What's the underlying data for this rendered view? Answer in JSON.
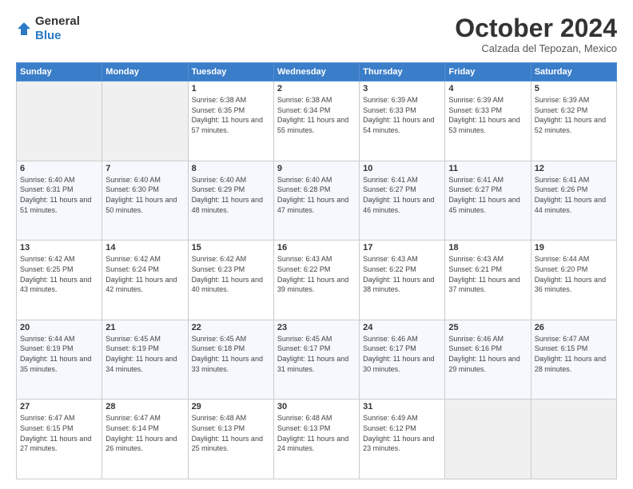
{
  "header": {
    "logo": {
      "general": "General",
      "blue": "Blue"
    },
    "title": "October 2024",
    "location": "Calzada del Tepozan, Mexico"
  },
  "weekdays": [
    "Sunday",
    "Monday",
    "Tuesday",
    "Wednesday",
    "Thursday",
    "Friday",
    "Saturday"
  ],
  "weeks": [
    [
      {
        "day": "",
        "info": ""
      },
      {
        "day": "",
        "info": ""
      },
      {
        "day": "1",
        "info": "Sunrise: 6:38 AM\nSunset: 6:35 PM\nDaylight: 11 hours\nand 57 minutes."
      },
      {
        "day": "2",
        "info": "Sunrise: 6:38 AM\nSunset: 6:34 PM\nDaylight: 11 hours\nand 55 minutes."
      },
      {
        "day": "3",
        "info": "Sunrise: 6:39 AM\nSunset: 6:33 PM\nDaylight: 11 hours\nand 54 minutes."
      },
      {
        "day": "4",
        "info": "Sunrise: 6:39 AM\nSunset: 6:33 PM\nDaylight: 11 hours\nand 53 minutes."
      },
      {
        "day": "5",
        "info": "Sunrise: 6:39 AM\nSunset: 6:32 PM\nDaylight: 11 hours\nand 52 minutes."
      }
    ],
    [
      {
        "day": "6",
        "info": "Sunrise: 6:40 AM\nSunset: 6:31 PM\nDaylight: 11 hours\nand 51 minutes."
      },
      {
        "day": "7",
        "info": "Sunrise: 6:40 AM\nSunset: 6:30 PM\nDaylight: 11 hours\nand 50 minutes."
      },
      {
        "day": "8",
        "info": "Sunrise: 6:40 AM\nSunset: 6:29 PM\nDaylight: 11 hours\nand 48 minutes."
      },
      {
        "day": "9",
        "info": "Sunrise: 6:40 AM\nSunset: 6:28 PM\nDaylight: 11 hours\nand 47 minutes."
      },
      {
        "day": "10",
        "info": "Sunrise: 6:41 AM\nSunset: 6:27 PM\nDaylight: 11 hours\nand 46 minutes."
      },
      {
        "day": "11",
        "info": "Sunrise: 6:41 AM\nSunset: 6:27 PM\nDaylight: 11 hours\nand 45 minutes."
      },
      {
        "day": "12",
        "info": "Sunrise: 6:41 AM\nSunset: 6:26 PM\nDaylight: 11 hours\nand 44 minutes."
      }
    ],
    [
      {
        "day": "13",
        "info": "Sunrise: 6:42 AM\nSunset: 6:25 PM\nDaylight: 11 hours\nand 43 minutes."
      },
      {
        "day": "14",
        "info": "Sunrise: 6:42 AM\nSunset: 6:24 PM\nDaylight: 11 hours\nand 42 minutes."
      },
      {
        "day": "15",
        "info": "Sunrise: 6:42 AM\nSunset: 6:23 PM\nDaylight: 11 hours\nand 40 minutes."
      },
      {
        "day": "16",
        "info": "Sunrise: 6:43 AM\nSunset: 6:22 PM\nDaylight: 11 hours\nand 39 minutes."
      },
      {
        "day": "17",
        "info": "Sunrise: 6:43 AM\nSunset: 6:22 PM\nDaylight: 11 hours\nand 38 minutes."
      },
      {
        "day": "18",
        "info": "Sunrise: 6:43 AM\nSunset: 6:21 PM\nDaylight: 11 hours\nand 37 minutes."
      },
      {
        "day": "19",
        "info": "Sunrise: 6:44 AM\nSunset: 6:20 PM\nDaylight: 11 hours\nand 36 minutes."
      }
    ],
    [
      {
        "day": "20",
        "info": "Sunrise: 6:44 AM\nSunset: 6:19 PM\nDaylight: 11 hours\nand 35 minutes."
      },
      {
        "day": "21",
        "info": "Sunrise: 6:45 AM\nSunset: 6:19 PM\nDaylight: 11 hours\nand 34 minutes."
      },
      {
        "day": "22",
        "info": "Sunrise: 6:45 AM\nSunset: 6:18 PM\nDaylight: 11 hours\nand 33 minutes."
      },
      {
        "day": "23",
        "info": "Sunrise: 6:45 AM\nSunset: 6:17 PM\nDaylight: 11 hours\nand 31 minutes."
      },
      {
        "day": "24",
        "info": "Sunrise: 6:46 AM\nSunset: 6:17 PM\nDaylight: 11 hours\nand 30 minutes."
      },
      {
        "day": "25",
        "info": "Sunrise: 6:46 AM\nSunset: 6:16 PM\nDaylight: 11 hours\nand 29 minutes."
      },
      {
        "day": "26",
        "info": "Sunrise: 6:47 AM\nSunset: 6:15 PM\nDaylight: 11 hours\nand 28 minutes."
      }
    ],
    [
      {
        "day": "27",
        "info": "Sunrise: 6:47 AM\nSunset: 6:15 PM\nDaylight: 11 hours\nand 27 minutes."
      },
      {
        "day": "28",
        "info": "Sunrise: 6:47 AM\nSunset: 6:14 PM\nDaylight: 11 hours\nand 26 minutes."
      },
      {
        "day": "29",
        "info": "Sunrise: 6:48 AM\nSunset: 6:13 PM\nDaylight: 11 hours\nand 25 minutes."
      },
      {
        "day": "30",
        "info": "Sunrise: 6:48 AM\nSunset: 6:13 PM\nDaylight: 11 hours\nand 24 minutes."
      },
      {
        "day": "31",
        "info": "Sunrise: 6:49 AM\nSunset: 6:12 PM\nDaylight: 11 hours\nand 23 minutes."
      },
      {
        "day": "",
        "info": ""
      },
      {
        "day": "",
        "info": ""
      }
    ]
  ]
}
